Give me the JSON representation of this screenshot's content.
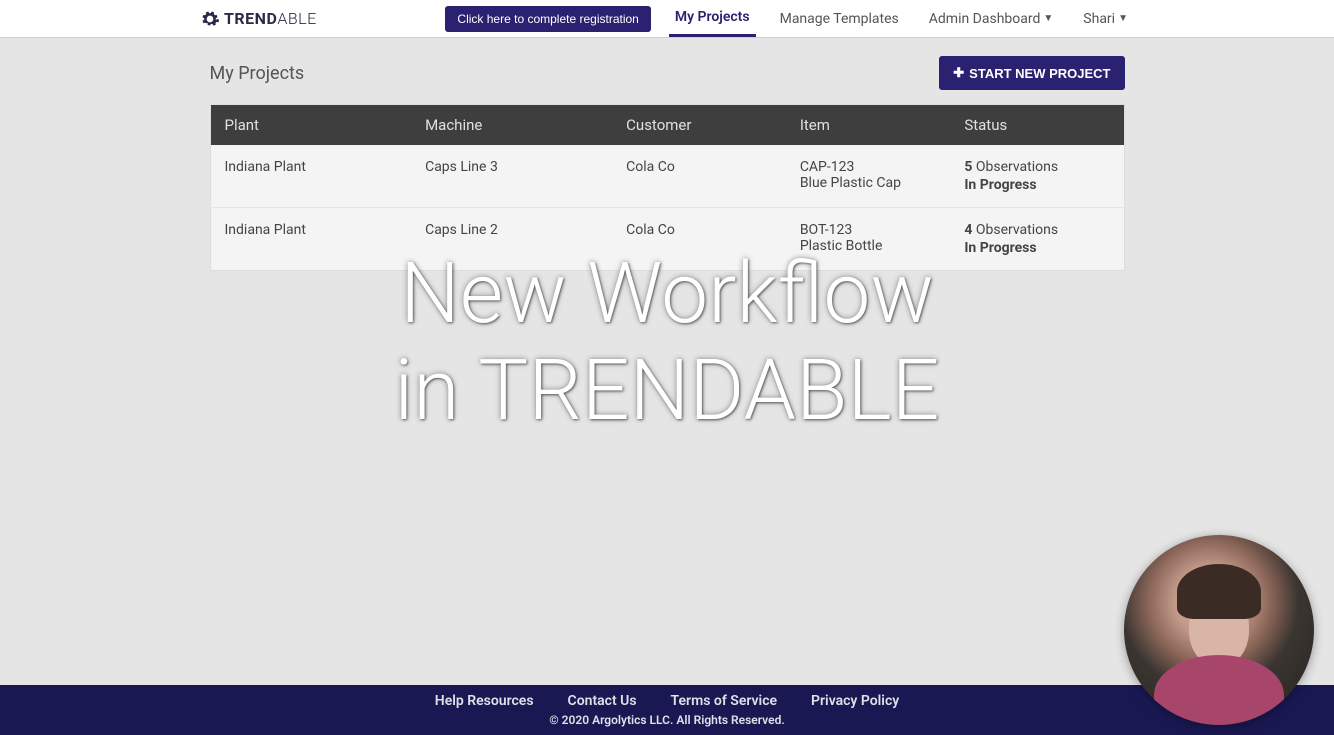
{
  "logo": {
    "normal": "TREND",
    "light": "ABLE"
  },
  "nav": {
    "registration_btn": "Click here to complete registration",
    "my_projects": "My Projects",
    "manage_templates": "Manage Templates",
    "admin_dashboard": "Admin Dashboard",
    "user_name": "Shari"
  },
  "page": {
    "title": "My Projects",
    "start_btn": "START NEW PROJECT"
  },
  "table": {
    "headers": {
      "plant": "Plant",
      "machine": "Machine",
      "customer": "Customer",
      "item": "Item",
      "status": "Status"
    },
    "rows": [
      {
        "plant": "Indiana Plant",
        "machine": "Caps Line 3",
        "customer": "Cola Co",
        "item_code": "CAP-123",
        "item_name": "Blue Plastic Cap",
        "obs_count": "5",
        "obs_label": " Observations",
        "status": "In Progress"
      },
      {
        "plant": "Indiana Plant",
        "machine": "Caps Line 2",
        "customer": "Cola Co",
        "item_code": "BOT-123",
        "item_name": "Plastic Bottle",
        "obs_count": "4",
        "obs_label": " Observations",
        "status": "In Progress"
      }
    ]
  },
  "overlay": {
    "line1": "New Workflow",
    "line2": "in TRENDABLE"
  },
  "footer": {
    "links": {
      "help": "Help Resources",
      "contact": "Contact Us",
      "terms": "Terms of Service",
      "privacy": "Privacy Policy"
    },
    "copyright": "© 2020 Argolytics LLC. All Rights Reserved."
  }
}
